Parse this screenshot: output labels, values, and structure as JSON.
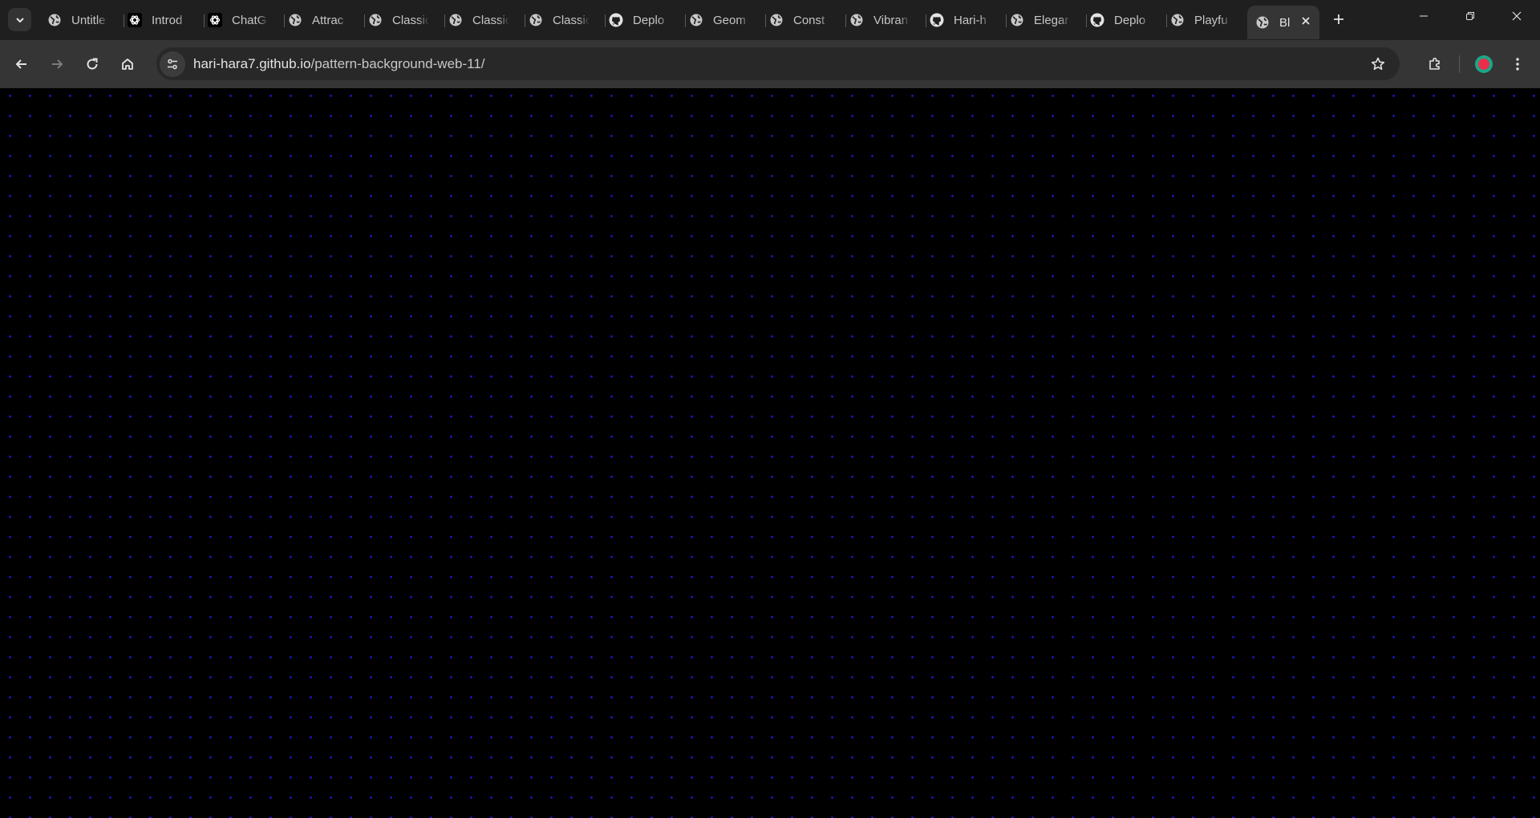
{
  "browser": {
    "tabs": [
      {
        "title": "Untitle",
        "icon": "globe-icon"
      },
      {
        "title": "Introd",
        "icon": "openai-icon"
      },
      {
        "title": "ChatG",
        "icon": "openai-icon"
      },
      {
        "title": "Attrac",
        "icon": "globe-icon"
      },
      {
        "title": "Classic",
        "icon": "globe-icon"
      },
      {
        "title": "Classic",
        "icon": "globe-icon"
      },
      {
        "title": "Classic",
        "icon": "globe-icon"
      },
      {
        "title": "Deplo",
        "icon": "github-icon"
      },
      {
        "title": "Geom",
        "icon": "globe-icon"
      },
      {
        "title": "Const",
        "icon": "globe-icon"
      },
      {
        "title": "Vibran",
        "icon": "globe-icon"
      },
      {
        "title": "Hari-h",
        "icon": "github-icon"
      },
      {
        "title": "Elegar",
        "icon": "globe-icon"
      },
      {
        "title": "Deplo",
        "icon": "github-icon"
      },
      {
        "title": "Playfu",
        "icon": "globe-icon"
      },
      {
        "title": "Bl",
        "icon": "globe-icon",
        "active": true
      }
    ],
    "address": {
      "host": "hari-hara7.github.io",
      "path": "/pattern-background-web-11/"
    }
  },
  "page": {
    "background_color": "#000000",
    "dot_color": "#1b1bd8"
  }
}
